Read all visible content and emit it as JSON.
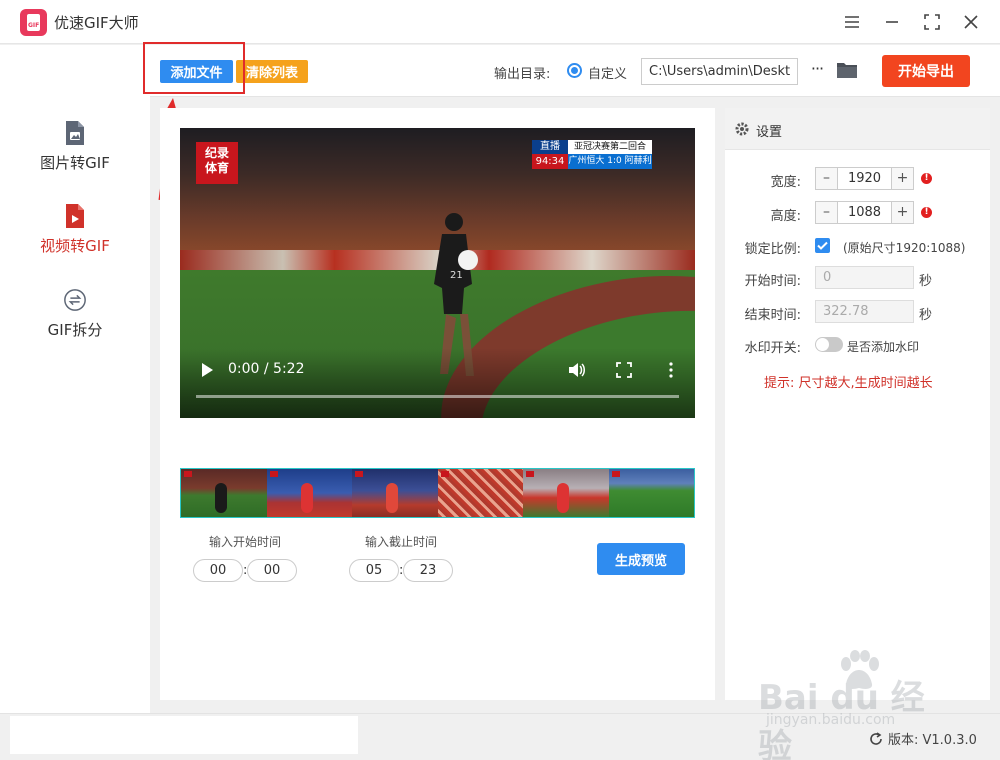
{
  "app": {
    "title": "优速GIF大师"
  },
  "sidebar": {
    "items": [
      {
        "label": "图片转GIF",
        "active": false
      },
      {
        "label": "视频转GIF",
        "active": true
      },
      {
        "label": "GIF拆分",
        "active": false
      }
    ]
  },
  "toolbar": {
    "add_file": "添加文件",
    "clear_list": "清除列表",
    "output_dir_label": "输出目录:",
    "custom_label": "自定义",
    "output_path": "C:\\Users\\admin\\Deskto",
    "more": "···",
    "export": "开始导出"
  },
  "video": {
    "logo_line1": "纪录",
    "logo_line2": "体育",
    "score_live": "直播",
    "score_title": "亚冠决赛第二回合",
    "score_time": "94:34",
    "score_result": "广州恒大 1:0 阿赫利",
    "time_display": "0:00 / 5:22"
  },
  "clip": {
    "start_caption": "输入开始时间",
    "end_caption": "输入截止时间",
    "start_min": "00",
    "start_sec": "00",
    "end_min": "05",
    "end_sec": "23",
    "preview_button": "生成预览"
  },
  "settings": {
    "title": "设置",
    "width_label": "宽度:",
    "width_value": "1920",
    "height_label": "高度:",
    "height_value": "1088",
    "lock_label": "锁定比例:",
    "lock_checked": true,
    "original_size": "(原始尺寸1920:1088)",
    "start_label": "开始时间:",
    "start_value": "0",
    "end_label": "结束时间:",
    "end_value": "322.78",
    "sec_unit": "秒",
    "watermark_label": "水印开关:",
    "watermark_toggle_text": "是否添加水印",
    "watermark_on": false,
    "hint": "提示: 尺寸越大,生成时间越长"
  },
  "footer": {
    "version": "版本: V1.0.3.0"
  },
  "overlay": {
    "watermark_main": "Bai du 经验",
    "watermark_sub": "jingyan.baidu.com"
  },
  "colors": {
    "accent_blue": "#2f8cf0",
    "export_red": "#f2451f",
    "clear_orange": "#f5a21c",
    "active_red": "#d0322a"
  }
}
